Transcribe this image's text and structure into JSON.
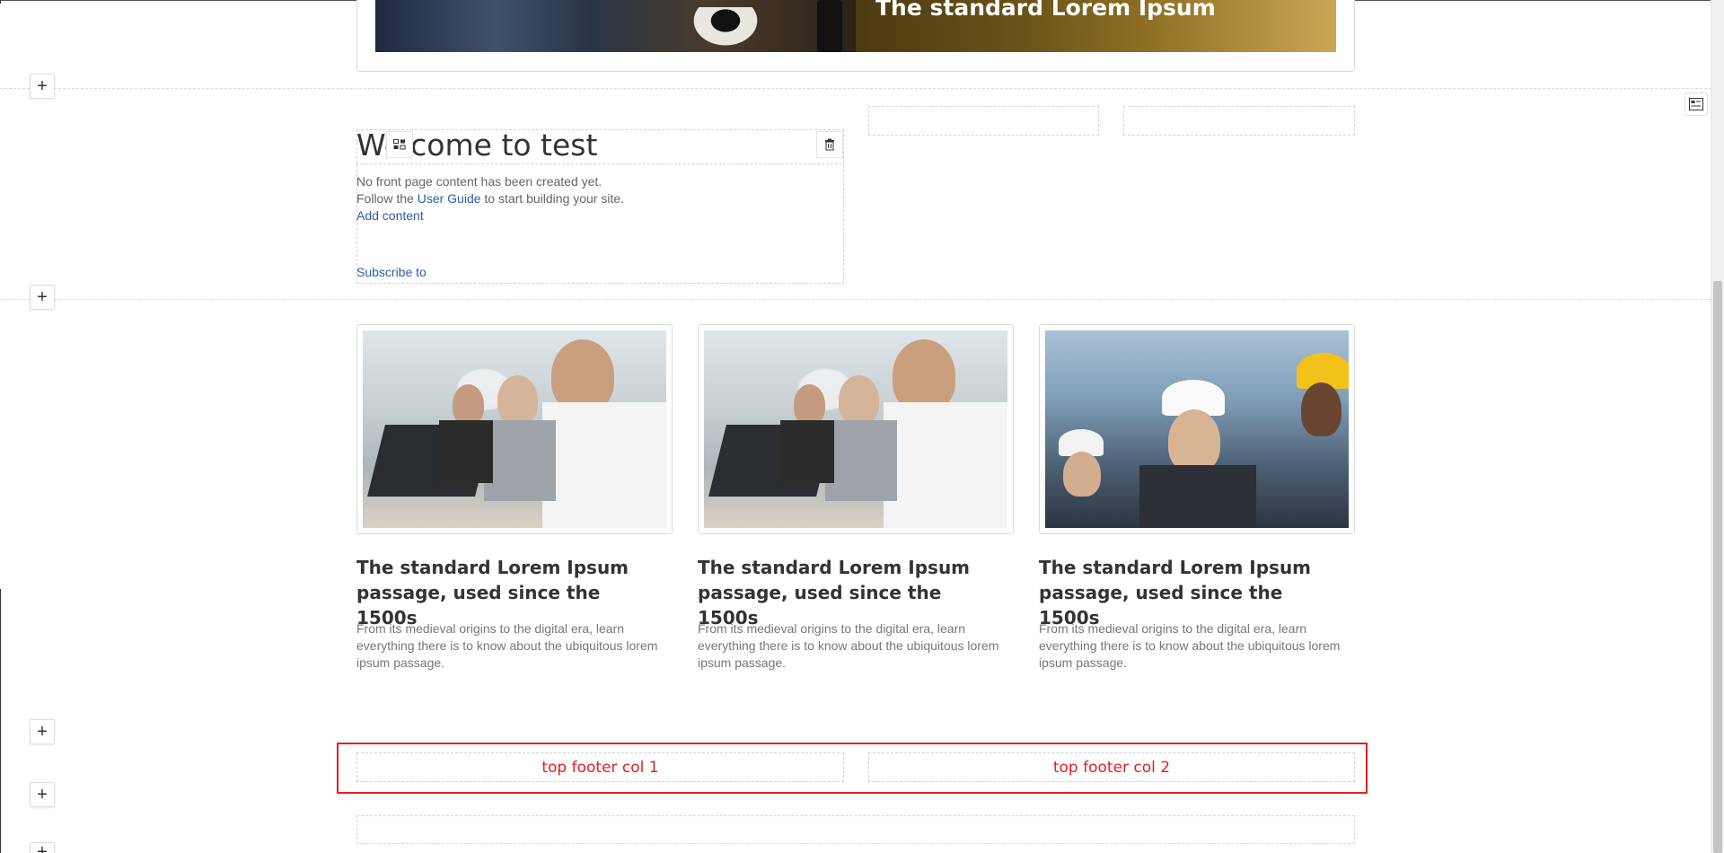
{
  "hero": {
    "title": "The standard Lorem Ipsum"
  },
  "welcome": {
    "title": "Welcome to test",
    "line1": "No front page content has been created yet.",
    "line2_prefix": "Follow the ",
    "line2_link": "User Guide",
    "line2_suffix": " to start building your site.",
    "add_content": "Add content",
    "subscribe": "Subscribe to"
  },
  "cards": [
    {
      "title": "The standard Lorem Ipsum passage, used since the 1500s",
      "description": "From its medieval origins to the digital era, learn everything there is to know about the ubiquitous lorem ipsum passage."
    },
    {
      "title": "The standard Lorem Ipsum passage, used since the 1500s",
      "description": "From its medieval origins to the digital era, learn everything there is to know about the ubiquitous lorem ipsum passage."
    },
    {
      "title": "The standard Lorem Ipsum passage, used since the 1500s",
      "description": "From its medieval origins to the digital era, learn everything there is to know about the ubiquitous lorem ipsum passage."
    }
  ],
  "footer": {
    "col1": "top footer col 1",
    "col2": "top footer col 2"
  },
  "controls": {
    "plus": "+"
  },
  "colors": {
    "highlight": "#e02020",
    "link": "#2e5ca8"
  }
}
